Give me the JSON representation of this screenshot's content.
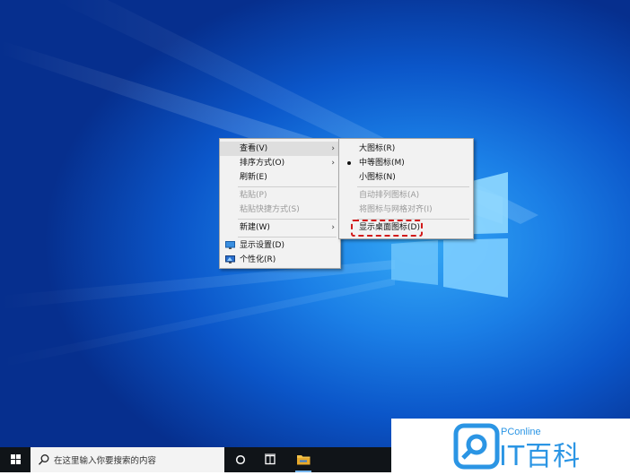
{
  "desktop": {
    "bg_color": "#0b56c9"
  },
  "context_menu": {
    "items": [
      {
        "label": "查看(V)",
        "submenu": true,
        "highlighted": true,
        "enabled": true
      },
      {
        "label": "排序方式(O)",
        "submenu": true,
        "enabled": true
      },
      {
        "label": "刷新(E)",
        "enabled": true
      },
      {
        "label": "粘贴(P)",
        "enabled": false
      },
      {
        "label": "粘贴快捷方式(S)",
        "enabled": false
      },
      {
        "label": "新建(W)",
        "submenu": true,
        "enabled": true
      },
      {
        "label": "显示设置(D)",
        "icon": "display-settings-icon",
        "enabled": true
      },
      {
        "label": "个性化(R)",
        "icon": "personalize-icon",
        "enabled": true
      }
    ],
    "submenu_arrow": "›"
  },
  "view_submenu": {
    "items": [
      {
        "label": "大图标(R)",
        "enabled": true
      },
      {
        "label": "中等图标(M)",
        "enabled": true,
        "selected": true
      },
      {
        "label": "小图标(N)",
        "enabled": true
      },
      {
        "label": "自动排列图标(A)",
        "enabled": false
      },
      {
        "label": "将图标与网格对齐(I)",
        "enabled": false
      },
      {
        "label": "显示桌面图标(D)",
        "enabled": true,
        "emphasized": true
      }
    ],
    "emphasis_color": "#d21a1a"
  },
  "taskbar": {
    "search_placeholder": "在这里输入你要搜索的内容",
    "icons": [
      "start-icon",
      "search-icon",
      "cortana-icon",
      "task-view-icon",
      "file-explorer-icon"
    ]
  },
  "watermark": {
    "brand_small": "PConline",
    "brand_big": "IT百科",
    "accent": "#2b95e4"
  }
}
